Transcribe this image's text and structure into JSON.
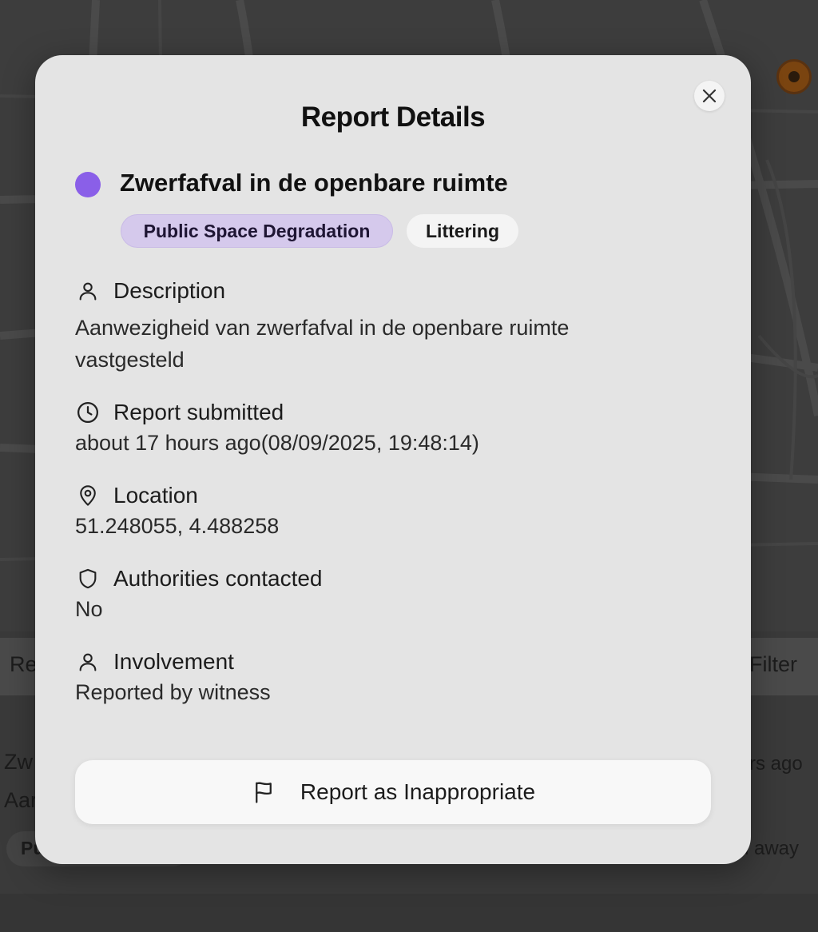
{
  "background": {
    "bar_left_text": "Re",
    "bar_right_text": "Filter",
    "card_title_fragment": "Zw",
    "card_desc_fragment": "Aar",
    "card_tag_fragment": "Pu",
    "card_time_fragment": "rs ago",
    "card_distance_fragment": "i away"
  },
  "modal": {
    "title": "Report Details",
    "report": {
      "title": "Zwerfafval in de openbare ruimte",
      "status_color": "#8a5fe8",
      "category_tag": "Public Space Degradation",
      "subcategory_tag": "Littering"
    },
    "sections": {
      "description": {
        "label": "Description",
        "value": "Aanwezigheid van zwerfafval in de openbare ruimte vastgesteld",
        "icon": "user-icon"
      },
      "submitted": {
        "label": "Report submitted",
        "value": "about 17 hours ago(08/09/2025, 19:48:14)",
        "icon": "clock-icon"
      },
      "location": {
        "label": "Location",
        "value": "51.248055, 4.488258",
        "icon": "map-pin-icon"
      },
      "authorities": {
        "label": "Authorities contacted",
        "value": "No",
        "icon": "shield-icon"
      },
      "involvement": {
        "label": "Involvement",
        "value": "Reported by witness",
        "icon": "user-icon"
      }
    },
    "report_button_label": "Report as Inappropriate"
  }
}
